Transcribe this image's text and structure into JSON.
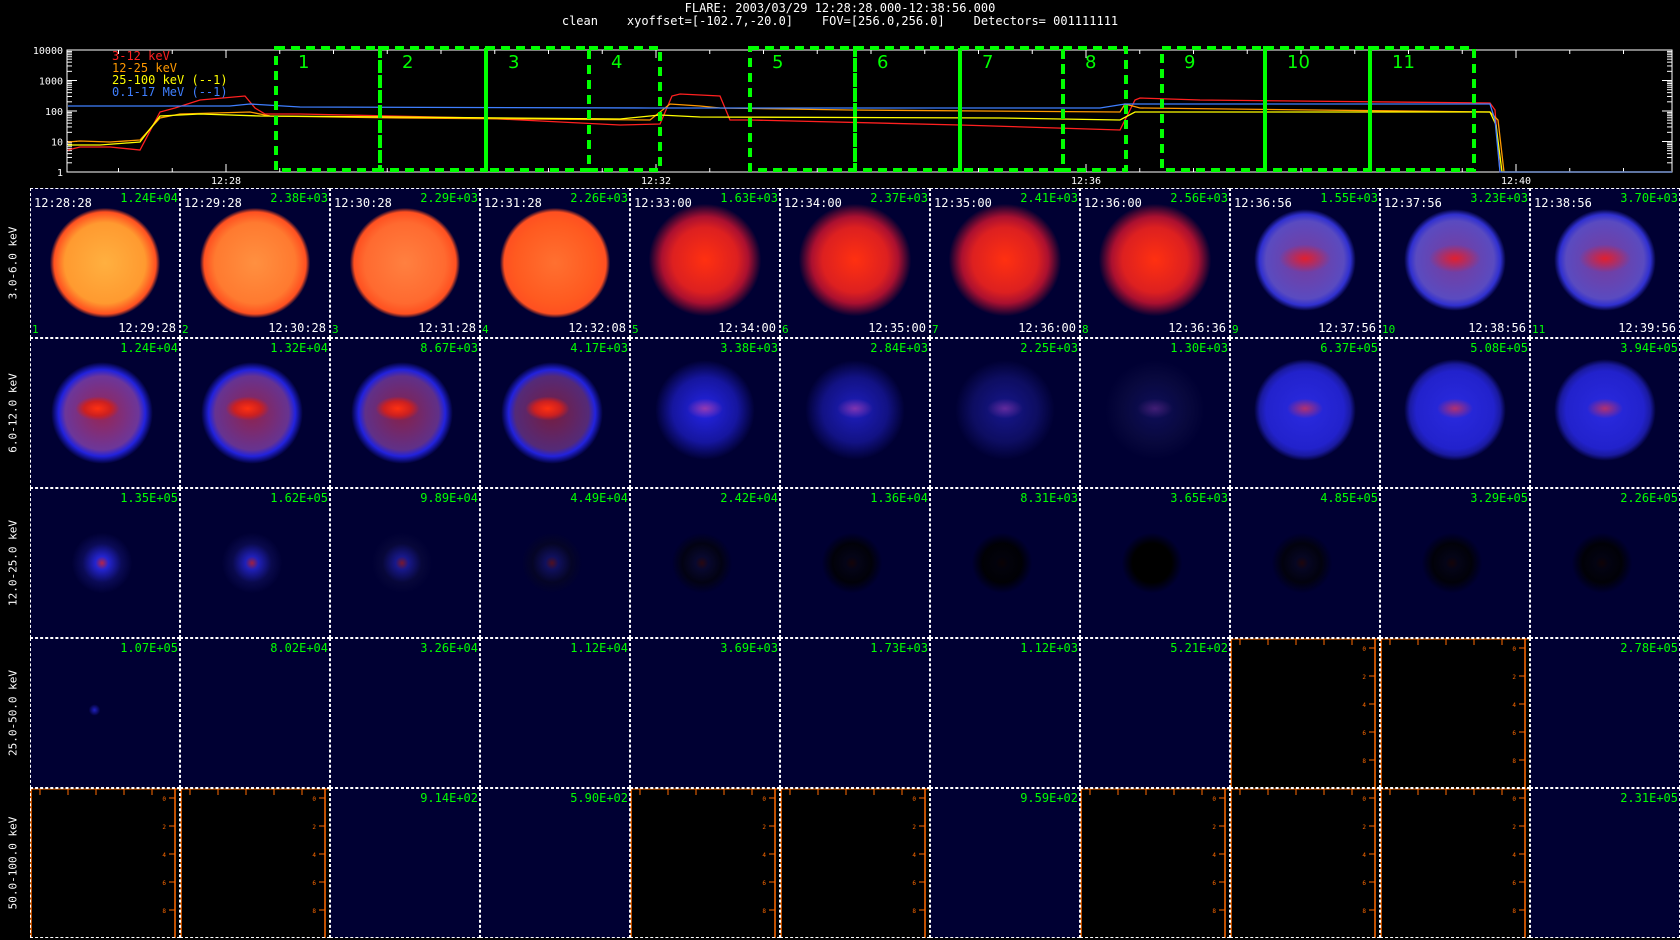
{
  "header": {
    "line1": "FLARE: 2003/03/29 12:28:28.000-12:38:56.000",
    "line2": "clean    xyoffset=[-102.7,-20.0]    FOV=[256.0,256.0]    Detectors= 001111111"
  },
  "lightcurve": {
    "y_ticks": [
      "10000",
      "1000",
      "100",
      "10",
      "1"
    ],
    "x_ticks": [
      "12:28",
      "12:32",
      "12:36",
      "12:40"
    ],
    "legend": [
      {
        "label": "3-12 keV",
        "color": "#ff2020"
      },
      {
        "label": "12-25 keV",
        "color": "#ff9900"
      },
      {
        "label": "25-100 keV (--1)",
        "color": "#ffff00"
      },
      {
        "label": "0.1-17 MeV (--1)",
        "color": "#3f7fff"
      }
    ],
    "intervals": [
      "1",
      "2",
      "3",
      "4",
      "5",
      "6",
      "7",
      "8",
      "9",
      "10",
      "11"
    ],
    "interval_color": "#00ff00"
  },
  "grid": {
    "row_labels": [
      "3.0-6.0 keV",
      "6.0-12.0 keV",
      "12.0-25.0 keV",
      "25.0-50.0 keV",
      "50.0-100.0 keV"
    ],
    "start_times": [
      "12:28:28",
      "12:29:28",
      "12:30:28",
      "12:31:28",
      "12:33:00",
      "12:34:00",
      "12:35:00",
      "12:36:00",
      "12:36:56",
      "12:37:56",
      "12:38:56"
    ],
    "end_times": [
      "12:29:28",
      "12:30:28",
      "12:31:28",
      "12:32:08",
      "12:34:00",
      "12:35:00",
      "12:36:00",
      "12:36:36",
      "12:37:56",
      "12:38:56",
      "12:39:56"
    ],
    "indices": [
      "1",
      "2",
      "3",
      "4",
      "5",
      "6",
      "7",
      "8",
      "9",
      "10",
      "11"
    ],
    "maxima": [
      [
        "1.24E+04",
        "2.38E+03",
        "2.29E+03",
        "2.26E+03",
        "1.63E+03",
        "2.37E+03",
        "2.41E+03",
        "2.56E+03",
        "1.55E+03",
        "3.23E+03",
        "3.70E+03"
      ],
      [
        "1.24E+04",
        "1.32E+04",
        "8.67E+03",
        "4.17E+03",
        "3.38E+03",
        "2.84E+03",
        "2.25E+03",
        "1.30E+03",
        "6.37E+05",
        "5.08E+05",
        "3.94E+05"
      ],
      [
        "1.35E+05",
        "1.62E+05",
        "9.89E+04",
        "4.49E+04",
        "2.42E+04",
        "1.36E+04",
        "8.31E+03",
        "3.65E+03",
        "4.85E+05",
        "3.29E+05",
        "2.26E+05"
      ],
      [
        "1.07E+05",
        "8.02E+04",
        "3.26E+04",
        "1.12E+04",
        "3.69E+03",
        "1.73E+03",
        "1.12E+03",
        "5.21E+02",
        "",
        "",
        "2.78E+05"
      ],
      [
        "",
        "",
        "9.14E+02",
        "5.90E+02",
        "",
        "",
        "9.59E+02",
        "",
        "",
        "",
        "2.31E+05"
      ]
    ],
    "empty_axis_ticks": [
      "0",
      "2",
      "4",
      "6",
      "8"
    ]
  }
}
